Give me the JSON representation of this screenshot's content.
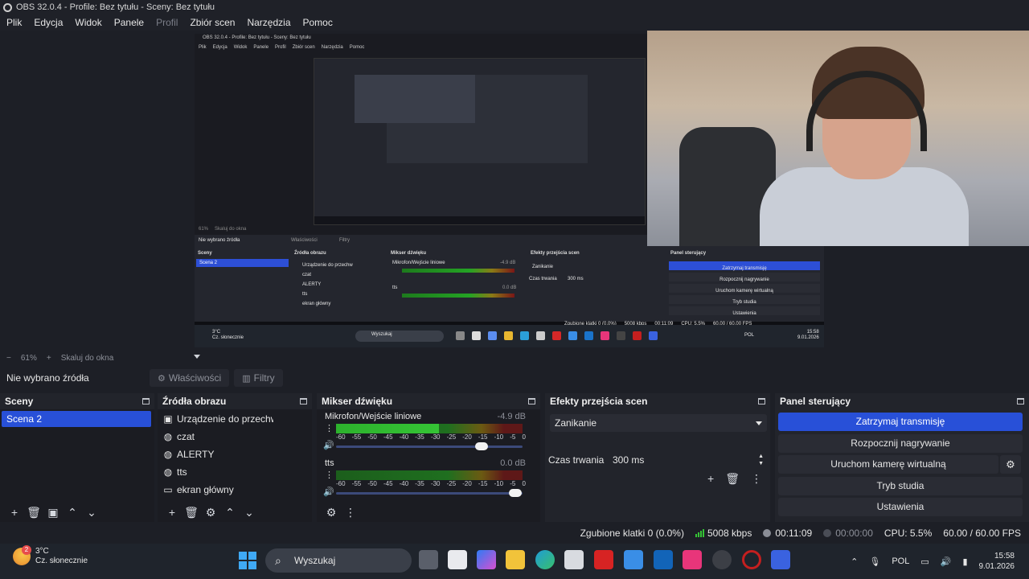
{
  "window": {
    "title": "OBS 32.0.4 - Profile: Bez tytułu - Sceny: Bez tytułu"
  },
  "menu": [
    "Plik",
    "Edycja",
    "Widok",
    "Panele",
    "Profil",
    "Zbiór scen",
    "Narzędzia",
    "Pomoc"
  ],
  "preview_mini": {
    "title": "OBS 32.0.4 - Profile: Bez tytułu - Sceny: Bez tytułu",
    "menu": [
      "Plik",
      "Edycja",
      "Widok",
      "Panele",
      "Profil",
      "Zbiór scen",
      "Narzędzia",
      "Pomoc"
    ],
    "zoom": "61%",
    "fit": "Skaluj do okna",
    "no_source": "Nie wybrano źródła",
    "properties": "Właściwości",
    "filters": "Filtry",
    "docks": [
      "Sceny",
      "Źródła obrazu",
      "Mikser dźwięku",
      "Efekty przejścia scen",
      "Panel sterujący"
    ],
    "scene": "Scena 2",
    "sources": [
      "Urządzenie do przechw",
      "czat",
      "ALERTY",
      "tts",
      "ekran główny"
    ],
    "mixer_track1": "Mikrofon/Wejście liniowe",
    "mixer_track1_db": "-4.9 dB",
    "mixer_track2": "tts",
    "mixer_track2_db": "0.0 dB",
    "transition": "Zanikanie",
    "duration_label": "Czas trwania",
    "duration": "300 ms",
    "controls": [
      "Zatrzymaj transmisję",
      "Rozpocznij nagrywanie",
      "Uruchom kamerę wirtualną",
      "Tryb studia",
      "Ustawienia"
    ],
    "status": {
      "dropped": "Zgubione klatki 0 (0.0%)",
      "bitrate": "5008 kbps",
      "live": "00:11:09",
      "cpu": "CPU: 5.5%",
      "fps": "60.00 / 60.00 FPS"
    },
    "weather_temp": "3°C",
    "weather_desc": "Cz. słonecznie",
    "search": "Wyszukaj",
    "lang": "POL",
    "time": "15:58",
    "date": "9.01.2026"
  },
  "zoom": {
    "level": "61%",
    "fit_label": "Skaluj do okna"
  },
  "context": {
    "no_source": "Nie wybrano źródła",
    "properties": "Właściwości",
    "filters": "Filtry"
  },
  "scenes": {
    "title": "Sceny",
    "items": [
      "Scena 2"
    ]
  },
  "sources": {
    "title": "Źródła obrazu",
    "items": [
      {
        "name": "Urządzenie do przechw",
        "icon": "camera-icon"
      },
      {
        "name": "czat",
        "icon": "globe-icon"
      },
      {
        "name": "ALERTY",
        "icon": "globe-icon"
      },
      {
        "name": "tts",
        "icon": "globe-icon"
      },
      {
        "name": "ekran główny",
        "icon": "monitor-icon"
      }
    ]
  },
  "mixer": {
    "title": "Mikser dźwięku",
    "ticks": [
      "-60",
      "-55",
      "-50",
      "-45",
      "-40",
      "-35",
      "-30",
      "-25",
      "-20",
      "-15",
      "-10",
      "-5",
      "0"
    ],
    "tracks": [
      {
        "name": "Mikrofon/Wejście liniowe",
        "db": "-4.9 dB",
        "level": 0.55,
        "volume": 0.78
      },
      {
        "name": "tts",
        "db": "0.0 dB",
        "level": 0.0,
        "volume": 0.96
      }
    ]
  },
  "transitions": {
    "title": "Efekty przejścia scen",
    "selected": "Zanikanie",
    "duration_label": "Czas trwania",
    "duration": "300 ms"
  },
  "controls": {
    "title": "Panel sterujący",
    "stop_stream": "Zatrzymaj transmisję",
    "start_record": "Rozpocznij nagrywanie",
    "virtual_cam": "Uruchom kamerę wirtualną",
    "studio_mode": "Tryb studia",
    "settings": "Ustawienia"
  },
  "status": {
    "dropped": "Zgubione klatki 0 (0.0%)",
    "bitrate": "5008 kbps",
    "live_time": "00:11:09",
    "rec_time": "00:00:00",
    "cpu": "CPU: 5.5%",
    "fps": "60.00 / 60.00 FPS"
  },
  "taskbar": {
    "weather_temp": "3°C",
    "weather_desc": "Cz. słonecznie",
    "weather_badge": "2",
    "search": "Wyszukaj",
    "lang": "POL",
    "time": "15:58",
    "date": "9.01.2026"
  },
  "colors": {
    "accent": "#2850d8",
    "meter_green": "#35c435",
    "background": "#1d1f26"
  }
}
